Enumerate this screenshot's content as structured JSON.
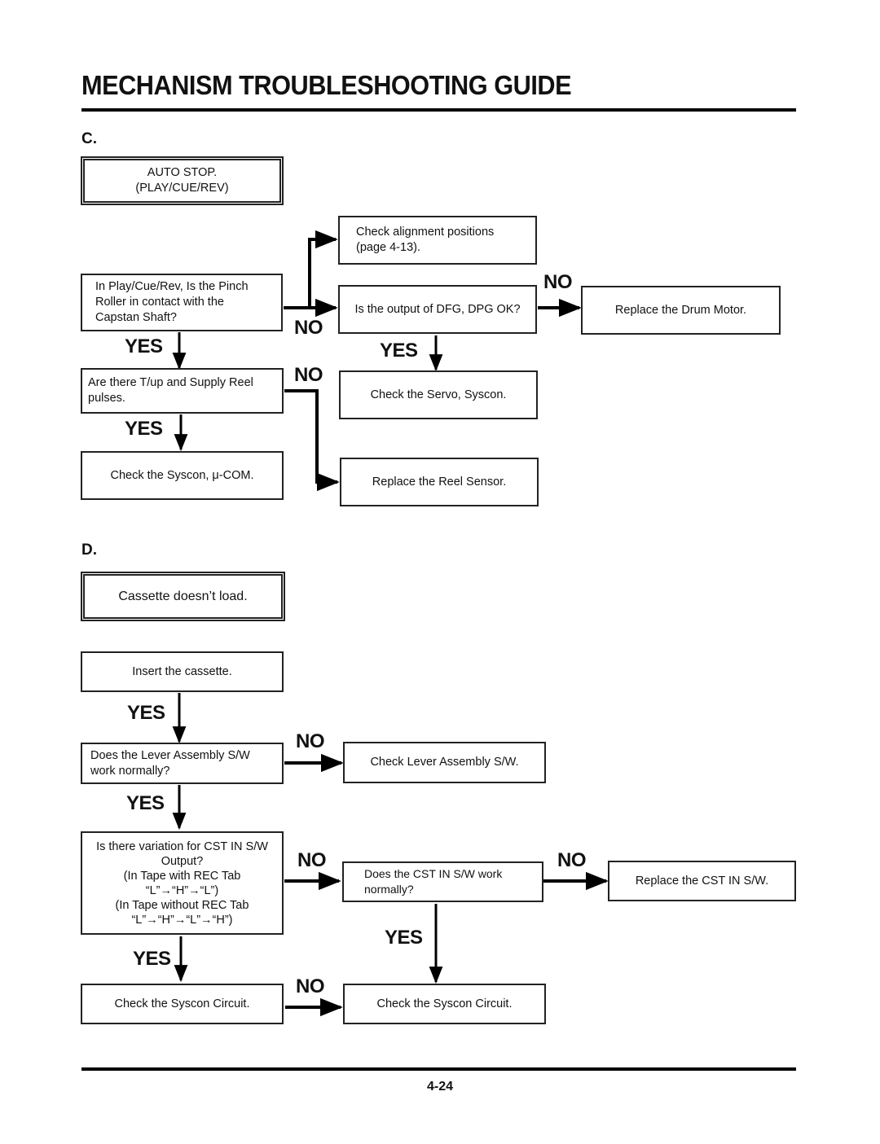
{
  "page": {
    "title": "MECHANISM TROUBLESHOOTING GUIDE",
    "page_number": "4-24"
  },
  "section_c": {
    "label": "C.",
    "start": "AUTO STOP.\n(PLAY/CUE/REV)",
    "q_pinch": "In Play/Cue/Rev, Is the Pinch\nRoller in contact with the\nCapstan Shaft?",
    "check_alignment": "Check alignment positions\n(page 4-13).",
    "q_dfg": "Is the output of DFG, DPG OK?",
    "replace_drum": "Replace the Drum Motor.",
    "q_reel": "Are there T/up and Supply Reel\npulses.",
    "check_servo": "Check the Servo, Syscon.",
    "check_syscon_ucom": "Check the Syscon, μ-COM.",
    "replace_reel": "Replace the Reel Sensor.",
    "labels": {
      "no_pinch": "NO",
      "yes_pinch": "YES",
      "no_dfg": "NO",
      "yes_dfg": "YES",
      "no_reel": "NO",
      "yes_reel": "YES"
    }
  },
  "section_d": {
    "label": "D.",
    "start": "Cassette doesn’t load.",
    "insert": "Insert the cassette.",
    "q_lever": "Does the Lever Assembly S/W\nwork normally?",
    "check_lever": "Check Lever Assembly S/W.",
    "q_variation": "Is there variation for CST IN S/W\nOutput?\n(In Tape with REC Tab\n“L”→“H”→“L”)\n(In Tape without REC Tab\n“L”→“H”→“L”→“H”)",
    "q_cst": "Does the CST IN S/W work\nnormally?",
    "replace_cst": "Replace the CST IN S/W.",
    "check_syscon_1": "Check the Syscon Circuit.",
    "check_syscon_2": "Check the Syscon Circuit.",
    "labels": {
      "yes_insert": "YES",
      "no_lever": "NO",
      "yes_lever": "YES",
      "no_variation": "NO",
      "no_cst": "NO",
      "yes_cst": "YES",
      "yes_variation": "YES",
      "no_syscon": "NO"
    }
  }
}
